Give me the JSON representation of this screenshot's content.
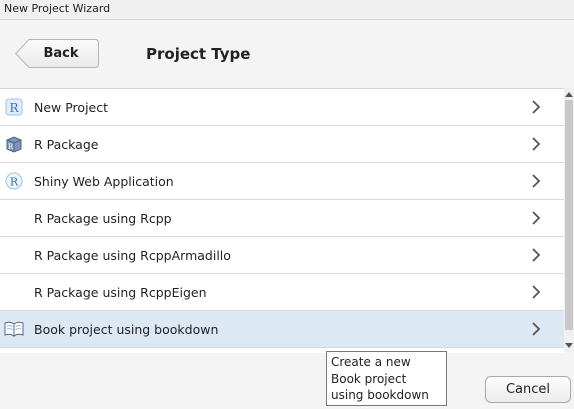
{
  "window": {
    "title": "New Project Wizard"
  },
  "header": {
    "back_label": "Back",
    "title": "Project Type"
  },
  "project_types": [
    {
      "label": "New Project",
      "icon": "r-project-icon"
    },
    {
      "label": "R Package",
      "icon": "r-package-icon"
    },
    {
      "label": "Shiny Web Application",
      "icon": "shiny-icon"
    },
    {
      "label": "R Package using Rcpp",
      "icon": ""
    },
    {
      "label": "R Package using RcppArmadillo",
      "icon": ""
    },
    {
      "label": "R Package using RcppEigen",
      "icon": ""
    },
    {
      "label": "Book project using bookdown",
      "icon": "book-icon"
    }
  ],
  "selected_index": 6,
  "tooltip": {
    "text": "Create a new Book project using bookdown"
  },
  "footer": {
    "cancel_label": "Cancel"
  },
  "colors": {
    "selected_row": "#dde8f5",
    "r_blue": "#5a8fc9"
  }
}
